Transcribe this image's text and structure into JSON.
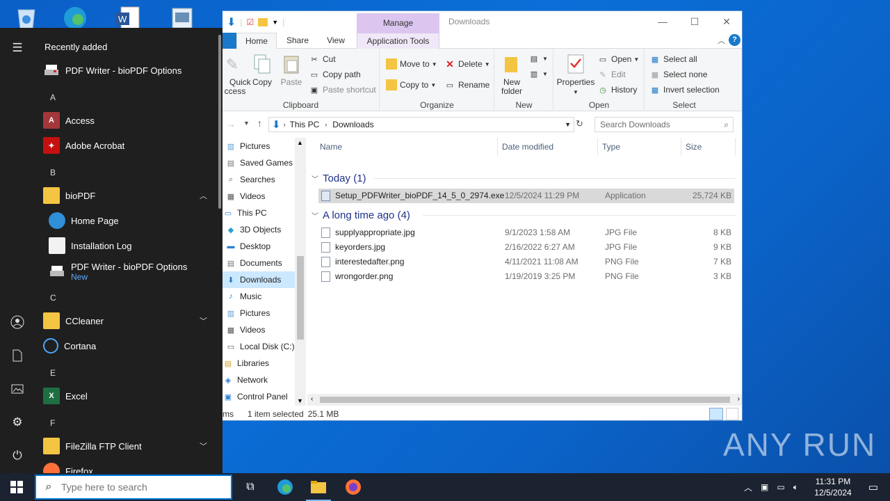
{
  "watermark": "ANY RUN",
  "colors": {
    "accent": "#0078d7",
    "manage": "#dcc6f0",
    "selected_nav": "#cce8ff"
  },
  "start_menu": {
    "recently_added": "Recently added",
    "recent_item": "PDF Writer - bioPDF Options",
    "letters": {
      "a": "A",
      "b": "B",
      "c": "C",
      "e": "E",
      "f": "F"
    },
    "items": {
      "access": "Access",
      "acrobat": "Adobe Acrobat",
      "biopdf": "bioPDF",
      "homepage": "Home Page",
      "installlog": "Installation Log",
      "pdfwriter": "PDF Writer - bioPDF Options",
      "pdfwriter_badge": "New",
      "ccleaner": "CCleaner",
      "cortana": "Cortana",
      "excel": "Excel",
      "filezilla": "FileZilla FTP Client",
      "firefox": "Firefox"
    }
  },
  "taskbar": {
    "search_placeholder": "Type here to search",
    "time": "11:31 PM",
    "date": "12/5/2024"
  },
  "explorer": {
    "title": "Downloads",
    "manage": "Manage",
    "tabs": {
      "home": "Home",
      "share": "Share",
      "view": "View",
      "app_tools": "Application Tools"
    },
    "clipboard": {
      "quick": "Quick",
      "access": "ccess",
      "copy": "Copy",
      "paste": "Paste",
      "cut": "Cut",
      "copy_path": "Copy path",
      "paste_shortcut": "Paste shortcut",
      "name": "Clipboard"
    },
    "organize": {
      "move_to": "Move to",
      "copy_to": "Copy to",
      "delete": "Delete",
      "rename": "Rename",
      "name": "Organize"
    },
    "new": {
      "new_folder_1": "New",
      "new_folder_2": "folder",
      "name": "New"
    },
    "open": {
      "properties": "Properties",
      "open": "Open",
      "edit": "Edit",
      "history": "History",
      "name": "Open"
    },
    "select": {
      "select_all": "Select all",
      "select_none": "Select none",
      "invert": "Invert selection",
      "name": "Select"
    },
    "address": {
      "this_pc": "This PC",
      "downloads": "Downloads"
    },
    "search_placeholder": "Search Downloads",
    "nav": [
      "Pictures",
      "Saved Games",
      "Searches",
      "Videos",
      "This PC",
      "3D Objects",
      "Desktop",
      "Documents",
      "Downloads",
      "Music",
      "Pictures",
      "Videos",
      "Local Disk (C:)",
      "Libraries",
      "Network",
      "Control Panel"
    ],
    "columns": {
      "name": "Name",
      "date": "Date modified",
      "type": "Type",
      "size": "Size"
    },
    "groups": {
      "today": "Today (1)",
      "long_ago": "A long time ago (4)"
    },
    "files": [
      {
        "name": "Setup_PDFWriter_bioPDF_14_5_0_2974.exe",
        "date": "12/5/2024 11:29 PM",
        "type": "Application",
        "size": "25,724 KB"
      },
      {
        "name": "supplyappropriate.jpg",
        "date": "9/1/2023 1:58 AM",
        "type": "JPG File",
        "size": "8 KB"
      },
      {
        "name": "keyorders.jpg",
        "date": "2/16/2022 6:27 AM",
        "type": "JPG File",
        "size": "9 KB"
      },
      {
        "name": "interestedafter.png",
        "date": "4/11/2021 11:08 AM",
        "type": "PNG File",
        "size": "7 KB"
      },
      {
        "name": "wrongorder.png",
        "date": "1/19/2019 3:25 PM",
        "type": "PNG File",
        "size": "3 KB"
      }
    ],
    "status": {
      "items": "ms",
      "selected": "1 item selected",
      "size": "25.1 MB"
    }
  }
}
